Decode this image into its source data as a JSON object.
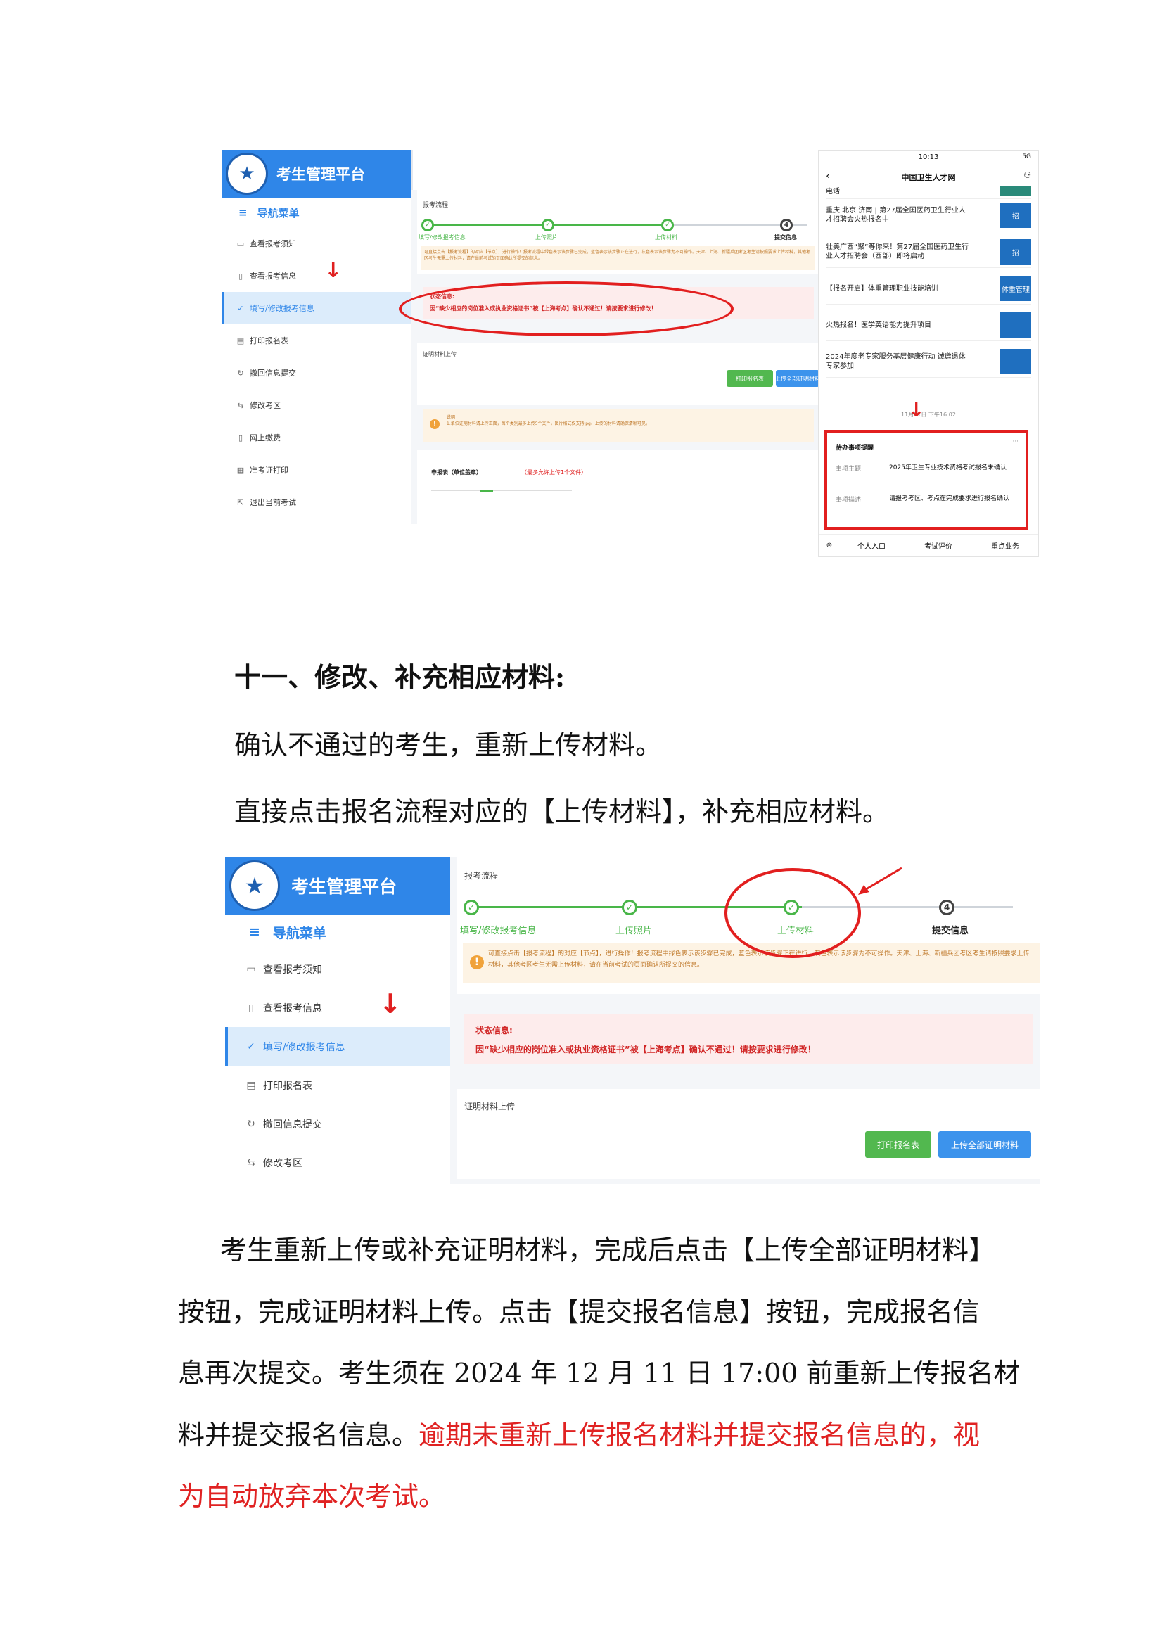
{
  "fig1": {
    "platform_title": "考生管理平台",
    "nav_title": "导航菜单",
    "nav_items": [
      "查看报考须知",
      "查看报考信息",
      "填写/修改报考信息",
      "打印报名表",
      "撤回信息提交",
      "修改考区",
      "网上缴费",
      "准考证打印",
      "退出当前考试"
    ],
    "section_label": "报考流程",
    "steps": [
      "填写/修改报考信息",
      "上传照片",
      "上传材料",
      "提交信息"
    ],
    "notice_text": "可直接点击【报考流程】的对应【节点】，进行操作！报考流程中绿色表示该步骤已完成，蓝色表示该步骤正在进行，灰色表示该步骤为不可操作。天津、上海、新疆兵团考区考生请按照要求上传材料，其他考区考生无需上传材料，请在当前考试的页面确认所提交的信息。",
    "status_title": "状态信息:",
    "status_text": "因“缺少相应的岗位准入或执业资格证书”被【上海考点】确认不通过！请按要求进行修改！",
    "upload_label": "证明材料上传",
    "btn_print": "打印报名表",
    "btn_upload_all": "上传全部证明材料",
    "tip_title": "说明",
    "tip_text": "1.单位证明材料请上传正面，每个类别最多上传5个文件，图片格式仅支持jpg、上传的材料请确保清晰可见。",
    "material_label": "申报表（单位盖章）",
    "material_hint": "（最多允许上传1个文件）"
  },
  "phone": {
    "time": "10:13",
    "status_right": "5G",
    "app_title": "中国卫生人才网",
    "news": [
      {
        "text": "电话",
        "thumb": ""
      },
      {
        "text": "重庆 北京 济南 | 第27届全国医药卫生行业人才招聘会火热报名中",
        "thumb": "招"
      },
      {
        "text": "壮美广西“聚”等你来！第27届全国医药卫生行业人才招聘会（西部）即将启动",
        "thumb": "招"
      },
      {
        "text": "【报名开启】体重管理职业技能培训",
        "thumb": "体重管理"
      },
      {
        "text": "火热报名！医学英语能力提升项目",
        "thumb": ""
      },
      {
        "text": "2024年度老专家服务基层健康行动 诚邀退休专家参加",
        "thumb": ""
      }
    ],
    "timestamp": "11月21日 下午16:02",
    "todo_title": "待办事项提醒",
    "todo_subject_label": "事项主题:",
    "todo_subject": "2025年卫生专业技术资格考试报名未确认",
    "todo_desc_label": "事项描述:",
    "todo_desc": "请报考考区、考点在完成要求进行报名确认",
    "tabbar": [
      "个人入口",
      "考试评价",
      "重点业务"
    ]
  },
  "doc": {
    "heading": "十一、修改、补充相应材料:",
    "para1": "确认不通过的考生，重新上传材料。",
    "para2": "直接点击报名流程对应的【上传材料】，补充相应材料。",
    "body_lines": [
      "考生重新上传或补充证明材料，完成后点击【上传全部证明材料】",
      "按钮，完成证明材料上传。点击【提交报名信息】按钮，完成报名信",
      "息再次提交。考生须在 2024 年 12 月 11 日 17:00 前重新上传报名材"
    ],
    "line4_black": "料并提交报名信息。",
    "line4_red": "逾期未重新上传报名材料并提交报名信息的，视",
    "line5_red": "为自动放弃本次考试。"
  },
  "fig2": {
    "platform_title": "考生管理平台",
    "nav_title": "导航菜单",
    "nav_items": [
      "查看报考须知",
      "查看报考信息",
      "填写/修改报考信息",
      "打印报名表",
      "撤回信息提交",
      "修改考区"
    ],
    "section_label": "报考流程",
    "steps": [
      "填写/修改报考信息",
      "上传照片",
      "上传材料",
      "提交信息"
    ],
    "notice_text": "可直接点击【报考流程】的对应【节点】，进行操作！报考流程中绿色表示该步骤已完成，蓝色表示该步骤正在进行，灰色表示该步骤为不可操作。天津、上海、新疆兵团考区考生请按照要求上传材料，其他考区考生无需上传材料，请在当前考试的页面确认所提交的信息。",
    "status_title": "状态信息:",
    "status_text": "因“缺少相应的岗位准入或执业资格证书”被【上海考点】确认不通过！请按要求进行修改！",
    "upload_label": "证明材料上传",
    "btn_print": "打印报名表",
    "btn_upload_all": "上传全部证明材料"
  }
}
